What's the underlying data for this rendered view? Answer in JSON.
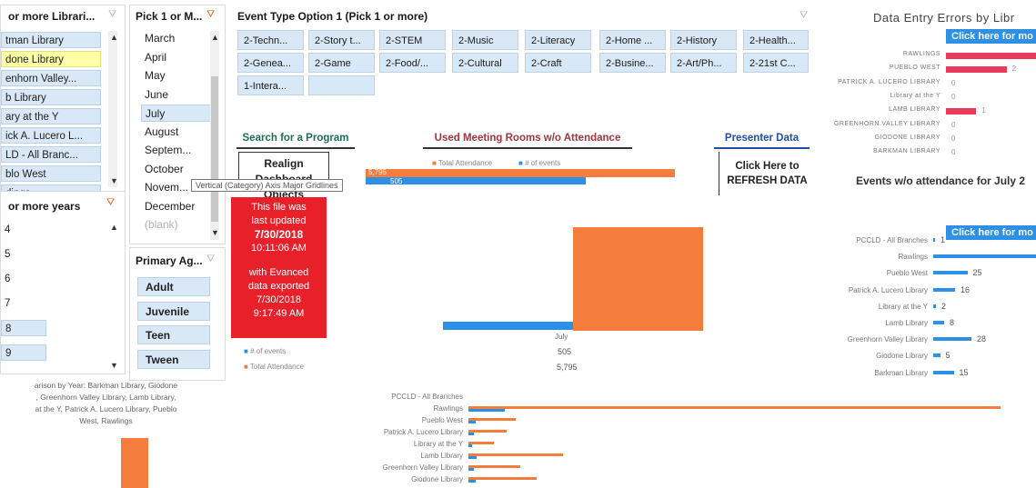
{
  "libraries_slicer": {
    "header": "or more Librari...",
    "items": [
      "tman Library",
      "done Library",
      "enhorn Valley...",
      "b Library",
      "ary at the Y",
      "ick A. Lucero L...",
      "LD - All Branc...",
      "blo West",
      "dings"
    ]
  },
  "years_slicer": {
    "header": "or more years",
    "items": [
      "4",
      "5",
      "6",
      "7",
      "8",
      "9"
    ]
  },
  "comparison_text": "arison by Year: Barkman Library, Giodone\n, Greenhorn Valley Library, Lamb Library,\n at the Y, Patrick A. Lucero Library, Pueblo\nWest, Rawlings",
  "months_slicer": {
    "header": "Pick 1 or M...",
    "items": [
      "March",
      "April",
      "May",
      "June",
      "July",
      "August",
      "Septem...",
      "October",
      "Novem...",
      "December",
      "(blank)"
    ],
    "selected": "July"
  },
  "primary_age_slicer": {
    "header": "Primary Ag...",
    "items": [
      "Adult",
      "Juvenile",
      "Teen",
      "Tween"
    ]
  },
  "event_type": {
    "header": "Event Type Option 1 (Pick 1 or more)",
    "buttons": [
      "2-Techn...",
      "2-Story t...",
      "2-STEM",
      "2-Music",
      "2-Literacy",
      "2-Home ...",
      "2-History",
      "2-Health...",
      "2-Genea...",
      "2-Game",
      "2-Food/...",
      "2-Cultural",
      "2-Craft",
      "2-Busine...",
      "2-Art/Ph...",
      "2-21st C...",
      "1-Intera...",
      ""
    ]
  },
  "links": {
    "search": "Search for a Program",
    "meeting_rooms": "Used Meeting Rooms w/o Attendance",
    "presenter": "Presenter Data"
  },
  "realign_button": "Realign Dashboard Objects",
  "refresh_button": "Click Here to REFRESH DATA",
  "tooltip": "Vertical (Category) Axis Major Gridlines",
  "update_box": {
    "line1": "This file was",
    "line2": "last updated",
    "date": "7/30/2018",
    "time": "10:11:06 AM",
    "line3": "with Evanced",
    "line4": "data exported",
    "date2": "7/30/2018",
    "time2": "9:17:49 AM"
  },
  "colors": {
    "orange": "#f47c3c",
    "blue": "#2e8fe6",
    "red_box": "#e8202a",
    "pink_bar": "#e8395a"
  },
  "top_bar_chart": {
    "legend": [
      "Total Attendance",
      "# of events"
    ],
    "labels": [
      "5,795",
      "505"
    ]
  },
  "chart_data": [
    {
      "type": "bar",
      "categories": [
        "July"
      ],
      "series": [
        {
          "name": "# of events",
          "values": [
            505
          ]
        },
        {
          "name": "Total Attendance",
          "values": [
            5795
          ]
        }
      ],
      "table_values": {
        "# of events": "505",
        "Total Attendance": "5,795"
      }
    },
    {
      "type": "bar",
      "title": "Data Entry Errors by Libr",
      "categories": [
        "RAWLINGS",
        "PUEBLO WEST",
        "PATRICK A. LUCERO LIBRARY",
        "Library at the Y",
        "LAMB LIBRARY",
        "GREENHORN VALLEY LIBRARY",
        "GIODONE LIBRARY",
        "BARKMAN LIBRARY"
      ],
      "values": [
        3,
        2,
        0,
        0,
        1,
        0,
        0,
        0
      ],
      "value_labels": [
        "",
        "2",
        "0",
        "0",
        "1",
        "0",
        "0",
        "0"
      ]
    },
    {
      "type": "bar",
      "title": "Events w/o attendance for July 2",
      "categories": [
        "PCCLD - All Branches",
        "Rawlings",
        "Pueblo West",
        "Patrick A. Lucero Library",
        "Library at the Y",
        "Lamb Library",
        "Greenhorn Valley Library",
        "Giodone Library",
        "Barkman Library"
      ],
      "values": [
        1,
        80,
        25,
        16,
        2,
        8,
        28,
        5,
        15
      ],
      "value_labels": [
        "1",
        "",
        "25",
        "16",
        "2",
        "8",
        "28",
        "5",
        "15"
      ]
    },
    {
      "type": "bar",
      "categories": [
        "PCCLD - All Branches",
        "Rawlings",
        "Pueblo West",
        "Patrick A. Lucero Library",
        "Library at the Y",
        "Lamb Library",
        "Greenhorn Valley Library",
        "Giodone Library"
      ],
      "series": [
        {
          "values": [
            0,
            620,
            55,
            45,
            30,
            110,
            60,
            80
          ]
        },
        {
          "values": [
            0,
            42,
            8,
            6,
            4,
            10,
            6,
            8
          ]
        }
      ]
    }
  ],
  "errors_link": "Click here for mo",
  "events_link": "Click here for mo"
}
